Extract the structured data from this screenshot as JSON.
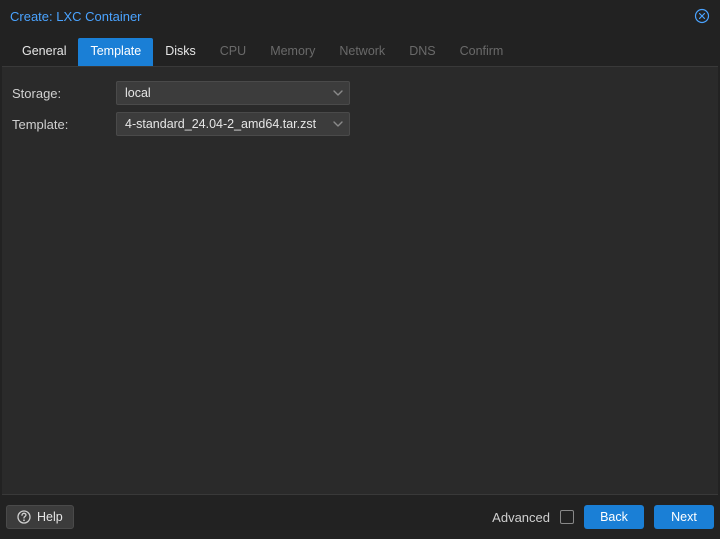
{
  "window": {
    "title": "Create: LXC Container"
  },
  "tabs": [
    {
      "id": "general",
      "label": "General",
      "state": "enabled"
    },
    {
      "id": "template",
      "label": "Template",
      "state": "active"
    },
    {
      "id": "disks",
      "label": "Disks",
      "state": "enabled"
    },
    {
      "id": "cpu",
      "label": "CPU",
      "state": "disabled"
    },
    {
      "id": "memory",
      "label": "Memory",
      "state": "disabled"
    },
    {
      "id": "network",
      "label": "Network",
      "state": "disabled"
    },
    {
      "id": "dns",
      "label": "DNS",
      "state": "disabled"
    },
    {
      "id": "confirm",
      "label": "Confirm",
      "state": "disabled"
    }
  ],
  "form": {
    "storage": {
      "label": "Storage:",
      "value": "local"
    },
    "template": {
      "label": "Template:",
      "value": "4-standard_24.04-2_amd64.tar.zst"
    }
  },
  "footer": {
    "help": "Help",
    "advanced": "Advanced",
    "advanced_checked": false,
    "back": "Back",
    "next": "Next"
  },
  "colors": {
    "accent": "#1a7fd6",
    "link": "#4aa3ff",
    "panel_bg": "#2a2a2a",
    "field_bg": "#3c3c3c"
  }
}
